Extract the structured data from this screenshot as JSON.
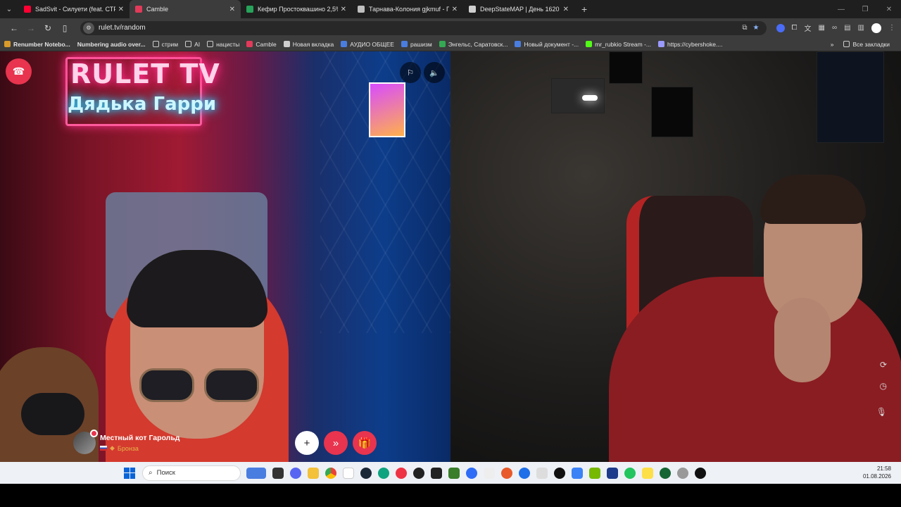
{
  "browser": {
    "tabs": [
      {
        "title": "SadSvit - Силуети (feat. СТРУК",
        "icon_color": "#ff0033",
        "active": false
      },
      {
        "title": "Camble",
        "icon_color": "#e23a5a",
        "active": true
      },
      {
        "title": "Кефир Простоквашино 2,5%, ",
        "icon_color": "#27a35a",
        "active": false
      },
      {
        "title": "Тарнава-Колония gjkmuf - По",
        "icon_color": "#bfbfbf",
        "active": false
      },
      {
        "title": "DeepStateMAP | День 1620 | М",
        "icon_color": "#d0d0d0",
        "active": false
      }
    ],
    "url": "rulet.tv/random",
    "bookmarks": [
      {
        "label": "Renumber Notebo...",
        "icon_color": "#d89a2a",
        "bold": true
      },
      {
        "label": "Numbering audio over...",
        "icon_color": "",
        "bold": true
      },
      {
        "label": "стрим",
        "icon_color": "folder"
      },
      {
        "label": "AI",
        "icon_color": "folder"
      },
      {
        "label": "нацисты",
        "icon_color": "folder"
      },
      {
        "label": "Camble",
        "icon_color": "#e23a5a"
      },
      {
        "label": "Новая вкладка",
        "icon_color": "#cfcfcf"
      },
      {
        "label": "АУДИО ОБЩЕЕ",
        "icon_color": "#4a7de0"
      },
      {
        "label": "рашизм",
        "icon_color": "#4a7de0"
      },
      {
        "label": "Энгельс, Саратовск...",
        "icon_color": "#34a853"
      },
      {
        "label": "Новый документ -...",
        "icon_color": "#4a7de0"
      },
      {
        "label": "mr_rubkio Stream -...",
        "icon_color": "#53fc18"
      },
      {
        "label": "https://cybershoke....",
        "icon_color": "#9a9aff"
      }
    ],
    "all_bookmarks": "Все закладки"
  },
  "call": {
    "partner_name": "Местный кот Гарольд",
    "partner_rank": "Бронза",
    "neon_sign_line1": "RULET TV",
    "neon_sign_line2": "Дядька Гарри"
  },
  "taskbar": {
    "search_placeholder": "Поиск",
    "time": "21:58",
    "date": "01.08.2026"
  }
}
